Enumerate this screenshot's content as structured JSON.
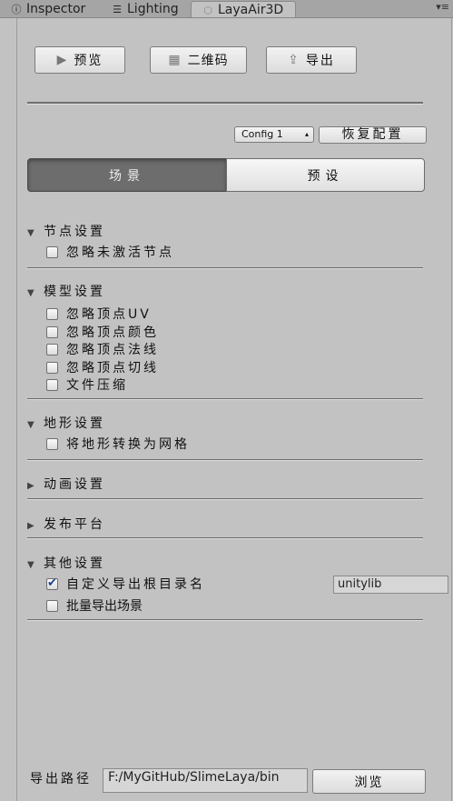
{
  "tabs": [
    {
      "label": "Inspector",
      "icon": "info-icon"
    },
    {
      "label": "Lighting",
      "icon": "sliders-icon"
    },
    {
      "label": "LayaAir3D",
      "icon": "laya-icon"
    }
  ],
  "toolbar": {
    "preview_label": "预览",
    "qrcode_label": "二维码",
    "export_label": "导出"
  },
  "config": {
    "selected": "Config 1",
    "reset_label": "恢复配置"
  },
  "mode_tabs": {
    "scene_label": "场景",
    "preset_label": "预设",
    "active": "scene"
  },
  "sections": {
    "node": {
      "title": "节点设置",
      "expanded": true,
      "options": [
        {
          "label": "忽略未激活节点",
          "checked": false
        }
      ]
    },
    "model": {
      "title": "模型设置",
      "expanded": true,
      "options": [
        {
          "label": "忽略顶点UV",
          "checked": false
        },
        {
          "label": "忽略顶点颜色",
          "checked": false
        },
        {
          "label": "忽略顶点法线",
          "checked": false
        },
        {
          "label": "忽略顶点切线",
          "checked": false
        },
        {
          "label": "文件压缩",
          "checked": false
        }
      ]
    },
    "terrain": {
      "title": "地形设置",
      "expanded": true,
      "options": [
        {
          "label": "将地形转换为网格",
          "checked": false
        }
      ]
    },
    "animation": {
      "title": "动画设置",
      "expanded": false
    },
    "platform": {
      "title": "发布平台",
      "expanded": false
    },
    "other": {
      "title": "其他设置",
      "expanded": true,
      "options": [
        {
          "label": "自定义导出根目录名",
          "checked": true
        },
        {
          "label": "批量导出场景",
          "checked": false
        }
      ],
      "root_name_value": "unitylib"
    }
  },
  "footer": {
    "path_label": "导出路径",
    "path_value": "F:/MyGitHub/SlimeLaya/bin",
    "browse_label": "浏览"
  }
}
